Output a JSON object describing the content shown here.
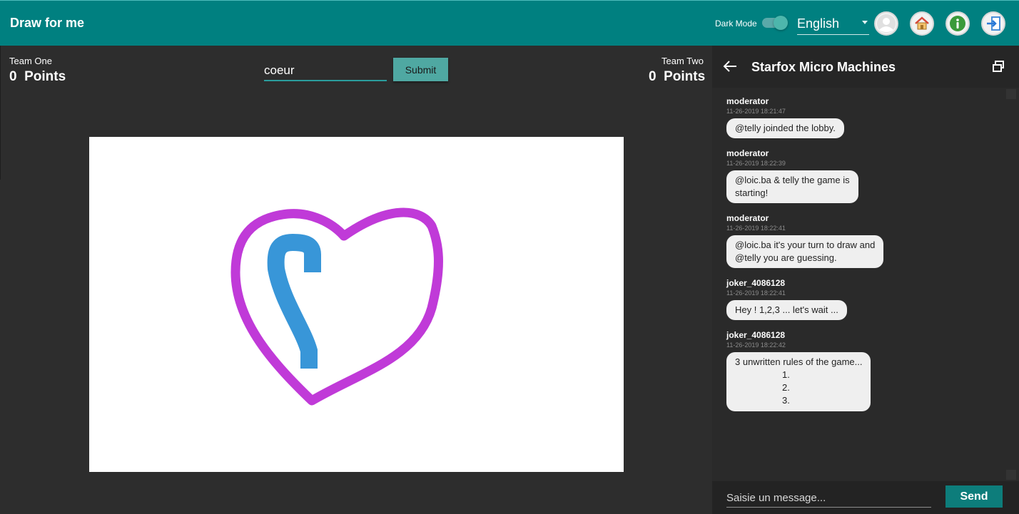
{
  "topbar": {
    "title": "Draw for me",
    "dark_mode_label": "Dark Mode",
    "dark_mode_on": true,
    "language": "English",
    "icons": [
      "avatar-icon",
      "home-icon",
      "info-icon",
      "logout-icon"
    ]
  },
  "game": {
    "team_one": {
      "label": "Team One",
      "points": "0  Points"
    },
    "team_two": {
      "label": "Team Two",
      "points": "0  Points"
    },
    "guess_value": "coeur",
    "submit_label": "Submit"
  },
  "chat": {
    "title": "Starfox Micro Machines",
    "messages": [
      {
        "author": "moderator",
        "time": "11-26-2019 18:21:47",
        "text": "@telly joinded the lobby."
      },
      {
        "author": "moderator",
        "time": "11-26-2019 18:22:39",
        "text_line1": "@loic.ba & telly the game is",
        "text_line2": "starting!"
      },
      {
        "author": "moderator",
        "time": "11-26-2019 18:22:41",
        "text_line1": "@loic.ba it's your turn to draw and",
        "text_line2": "@telly you are guessing."
      },
      {
        "author": "joker_4086128",
        "time": "11-26-2019 18:22:41",
        "text": "Hey ! 1,2,3 ... let's wait ..."
      },
      {
        "author": "joker_4086128",
        "time": "11-26-2019 18:22:42",
        "text": "3 unwritten rules of the game...",
        "items": [
          "1.",
          "2.",
          "3."
        ]
      }
    ],
    "input_placeholder": "Saisie un message...",
    "send_label": "Send"
  },
  "colors": {
    "topbar": "#008080",
    "background": "#2d2d2d",
    "stroke_purple": "#c03ad8",
    "stroke_blue": "#3896d8"
  }
}
